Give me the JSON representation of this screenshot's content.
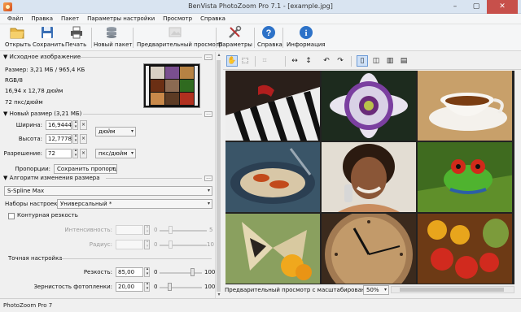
{
  "window": {
    "title": "BenVista PhotoZoom Pro 7.1 - [example.jpg]"
  },
  "menu": [
    "Файл",
    "Правка",
    "Пакет",
    "Параметры настройки",
    "Просмотр",
    "Справка"
  ],
  "toolbar": {
    "open": "Открыть",
    "save": "Сохранить",
    "print": "Печать",
    "new_batch": "Новый пакет",
    "preview_full": "Предварительный просмотр",
    "settings": "Параметры",
    "help": "Справка",
    "info": "Информация"
  },
  "source": {
    "header": "Исходное изображение",
    "size": "Размер: 3,21 МБ / 965,4 КБ",
    "mode": "RGB/8",
    "dims": "16,94 x 12,78 дюйм",
    "resolution": "72 пкс/дюйм"
  },
  "new_size": {
    "header": "Новый размер (3,21 МБ)",
    "width_label": "Ширина:",
    "width_value": "16,9444",
    "height_label": "Высота:",
    "height_value": "12,7778",
    "size_unit": "дюйм",
    "res_label": "Разрешение:",
    "res_value": "72",
    "res_unit": "пкс/дюйм",
    "proportions_label": "Пропорции:",
    "proportions_value": "Сохранить пропорции"
  },
  "algorithm": {
    "header": "Алгоритм изменения размера",
    "method": "S-Spline Max",
    "preset_label": "Наборы настроек:",
    "preset_value": "Универсальный *",
    "contour_label": "Контурная резкость",
    "intensity_label": "Интенсивность:",
    "intensity_min": "0",
    "intensity_max": "5",
    "radius_label": "Радиус:",
    "radius_min": "0",
    "radius_max": "10",
    "fine_header": "Точная настройка",
    "sharpness_label": "Резкость:",
    "sharpness_value": "85,00",
    "sharpness_min": "0",
    "sharpness_max": "100",
    "grain_label": "Зернистость фотопленки:",
    "grain_value": "20,00",
    "grain_min": "0",
    "grain_max": "100"
  },
  "preview": {
    "zoom_label": "Предварительный просмотр с масштабированием:",
    "zoom_value": "50%"
  },
  "status": {
    "text": "PhotoZoom Pro 7"
  }
}
